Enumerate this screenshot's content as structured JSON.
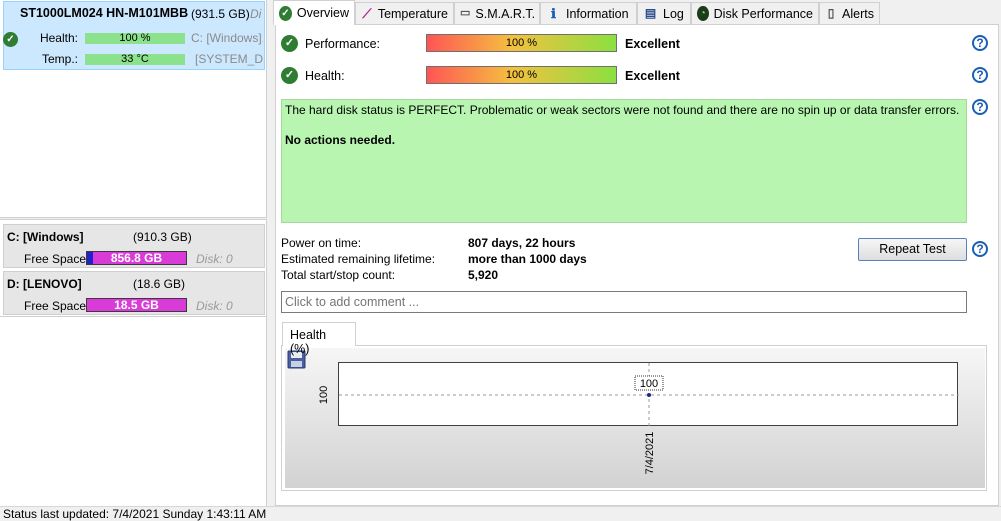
{
  "disk": {
    "title": "ST1000LM024 HN-M101MBB",
    "size": "(931.5 GB)",
    "truncated_suffix": "Di",
    "health_label": "Health:",
    "health_value": "100 %",
    "temp_label": "Temp.:",
    "temp_value": "33 °C",
    "partition_primary": "C: [Windows],",
    "partition_secondary": "[SYSTEM_DRV]"
  },
  "volumes": [
    {
      "name": "C: [Windows]",
      "size": "(910.3 GB)",
      "free_label": "Free Space",
      "free_value": "856.8 GB",
      "disk": "Disk: 0",
      "used_fraction": 0.06
    },
    {
      "name": "D: [LENOVO]",
      "size": "(18.6 GB)",
      "free_label": "Free Space",
      "free_value": "18.5 GB",
      "disk": "Disk: 0",
      "used_fraction": 0.0
    }
  ],
  "tabs": [
    {
      "label": "Overview",
      "icon": "check-icon"
    },
    {
      "label": "Temperature",
      "icon": "thermometer-icon"
    },
    {
      "label": "S.M.A.R.T.",
      "icon": "smart-icon"
    },
    {
      "label": "Information",
      "icon": "info-icon"
    },
    {
      "label": "Log",
      "icon": "log-icon"
    },
    {
      "label": "Disk Performance",
      "icon": "gauge-icon"
    },
    {
      "label": "Alerts",
      "icon": "alerts-icon"
    }
  ],
  "overview": {
    "performance_label": "Performance:",
    "performance_value": "100 %",
    "performance_rating": "Excellent",
    "health_label": "Health:",
    "health_value": "100 %",
    "health_rating": "Excellent",
    "status_message": "The hard disk status is PERFECT. Problematic or weak sectors were not found and there are no spin up or data transfer errors.",
    "action_message": "No actions needed.",
    "power_on_label": "Power on time:",
    "power_on_value": "807 days, 22 hours",
    "lifetime_label": "Estimated remaining lifetime:",
    "lifetime_value": "more than 1000 days",
    "startstop_label": "Total start/stop count:",
    "startstop_value": "5,920",
    "repeat_test_label": "Repeat Test",
    "comment_placeholder": "Click to add comment ...",
    "help_glyph": "?"
  },
  "chart_tab_label": "Health (%)",
  "chart_data": {
    "type": "line",
    "x": [
      "7/4/2021"
    ],
    "series": [
      {
        "values": [
          100
        ]
      }
    ],
    "data_labels": [
      "100"
    ],
    "ytick_labels": [
      "100"
    ],
    "xtick_labels": [
      "7/4/2021"
    ],
    "grid": true,
    "colors": {
      "line": "#1a2a8a",
      "grid": "#9a9a9a"
    }
  },
  "statusbar": {
    "text": "Status last updated: 7/4/2021 Sunday 1:43:11 AM"
  },
  "colors": {
    "selection": "#cce8ff",
    "ok_green": "#2e7d32",
    "free_space_bar": "#d83bd8",
    "status_box": "#b7f5b0"
  }
}
